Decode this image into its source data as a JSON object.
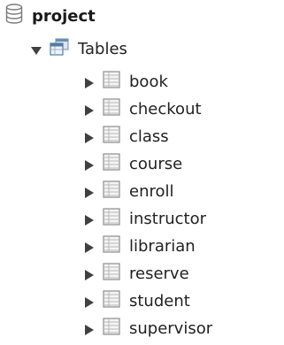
{
  "tree": {
    "database": {
      "label": "project",
      "icon": "database-icon",
      "expanded": true
    },
    "tables_group": {
      "label": "Tables",
      "icon": "tables-folder-icon",
      "expanded": true
    },
    "tables": [
      {
        "label": "book",
        "icon": "table-icon",
        "expanded": false
      },
      {
        "label": "checkout",
        "icon": "table-icon",
        "expanded": false
      },
      {
        "label": "class",
        "icon": "table-icon",
        "expanded": false
      },
      {
        "label": "course",
        "icon": "table-icon",
        "expanded": false
      },
      {
        "label": "enroll",
        "icon": "table-icon",
        "expanded": false
      },
      {
        "label": "instructor",
        "icon": "table-icon",
        "expanded": false
      },
      {
        "label": "librarian",
        "icon": "table-icon",
        "expanded": false
      },
      {
        "label": "reserve",
        "icon": "table-icon",
        "expanded": false
      },
      {
        "label": "student",
        "icon": "table-icon",
        "expanded": false
      },
      {
        "label": "supervisor",
        "icon": "table-icon",
        "expanded": false
      }
    ]
  },
  "colors": {
    "arrow": "#404040",
    "database_icon": "#7a7a7a",
    "tables_icon": "#4f7ea8",
    "table_icon_border": "#8c8c8c",
    "table_icon_line": "#b8b8b8"
  }
}
